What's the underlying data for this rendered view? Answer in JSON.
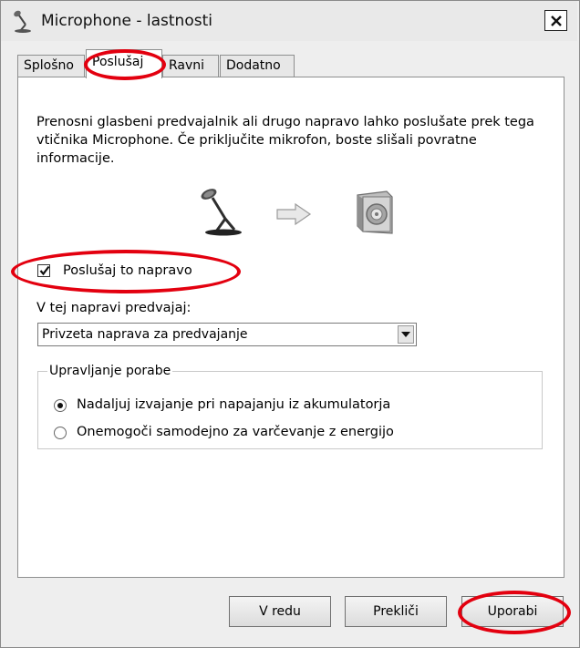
{
  "window": {
    "title": "Microphone - lastnosti"
  },
  "tabs": [
    {
      "label": "Splošno",
      "active": false
    },
    {
      "label": "Poslušaj",
      "active": true
    },
    {
      "label": "Ravni",
      "active": false
    },
    {
      "label": "Dodatno",
      "active": false
    }
  ],
  "panel": {
    "description": "Prenosni glasbeni predvajalnik ali drugo napravo lahko poslušate prek tega vtičnika Microphone.  Če priključite mikrofon, boste slišali povratne informacije.",
    "listen_checkbox": {
      "label": "Poslušaj to napravo",
      "checked": true
    },
    "playback_label": "V tej napravi predvajaj:",
    "playback_select": {
      "value": "Privzeta naprava za predvajanje"
    },
    "power_group": {
      "title": "Upravljanje porabe",
      "options": [
        {
          "label": "Nadaljuj izvajanje pri napajanju iz akumulatorja",
          "selected": true
        },
        {
          "label": "Onemogoči samodejno za varčevanje z energijo",
          "selected": false
        }
      ]
    }
  },
  "buttons": {
    "ok": "V redu",
    "cancel": "Prekliči",
    "apply": "Uporabi"
  },
  "colors": {
    "annotation_red": "#e3000f",
    "dialog_bg": "#eeeeee",
    "panel_bg": "#ffffff"
  },
  "icons": {
    "title": "microphone-icon",
    "source": "microphone-icon",
    "arrow": "arrow-right-icon",
    "target": "speaker-icon"
  }
}
